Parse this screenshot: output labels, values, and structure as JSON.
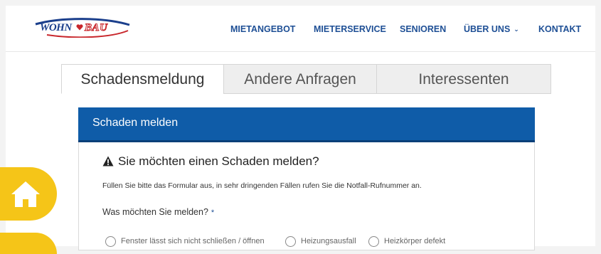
{
  "header": {
    "logo_wohn": "WOHN",
    "logo_bau": "BAU",
    "nav": [
      {
        "label": "MIETANGEBOT"
      },
      {
        "label": "MIETERSERVICE"
      },
      {
        "label": "SENIOREN"
      },
      {
        "label": "ÜBER UNS",
        "has_dropdown": true,
        "icon": "chevron-down-icon"
      },
      {
        "label": "KONTAKT"
      }
    ],
    "colors": {
      "nav": "#1e4f95",
      "logo_blue": "#1b3f8c",
      "logo_red": "#c8262b"
    }
  },
  "tabs": [
    {
      "label": "Schadensmeldung",
      "active": true
    },
    {
      "label": "Andere Anfragen",
      "active": false
    },
    {
      "label": "Interessenten",
      "active": false
    }
  ],
  "card": {
    "title": "Schaden melden",
    "header_color": "#0f5ca8",
    "warning_icon": "warning-triangle-icon",
    "question_heading": "Sie möchten einen Schaden melden?",
    "info_text": "Füllen Sie bitte das Formular aus, in sehr dringenden Fällen rufen Sie die Notfall-Rufnummer an.",
    "form_label": "Was möchten Sie melden?",
    "required_marker": "*",
    "options": [
      {
        "label": "Fenster lässt sich nicht schließen / öffnen",
        "selected": false
      },
      {
        "label": "Heizungsausfall",
        "selected": false
      },
      {
        "label": "Heizkörper defekt",
        "selected": false
      }
    ]
  },
  "sidebar": {
    "color": "#f5c518",
    "buttons": [
      {
        "icon": "home-icon"
      },
      {
        "icon": "unknown"
      }
    ]
  }
}
